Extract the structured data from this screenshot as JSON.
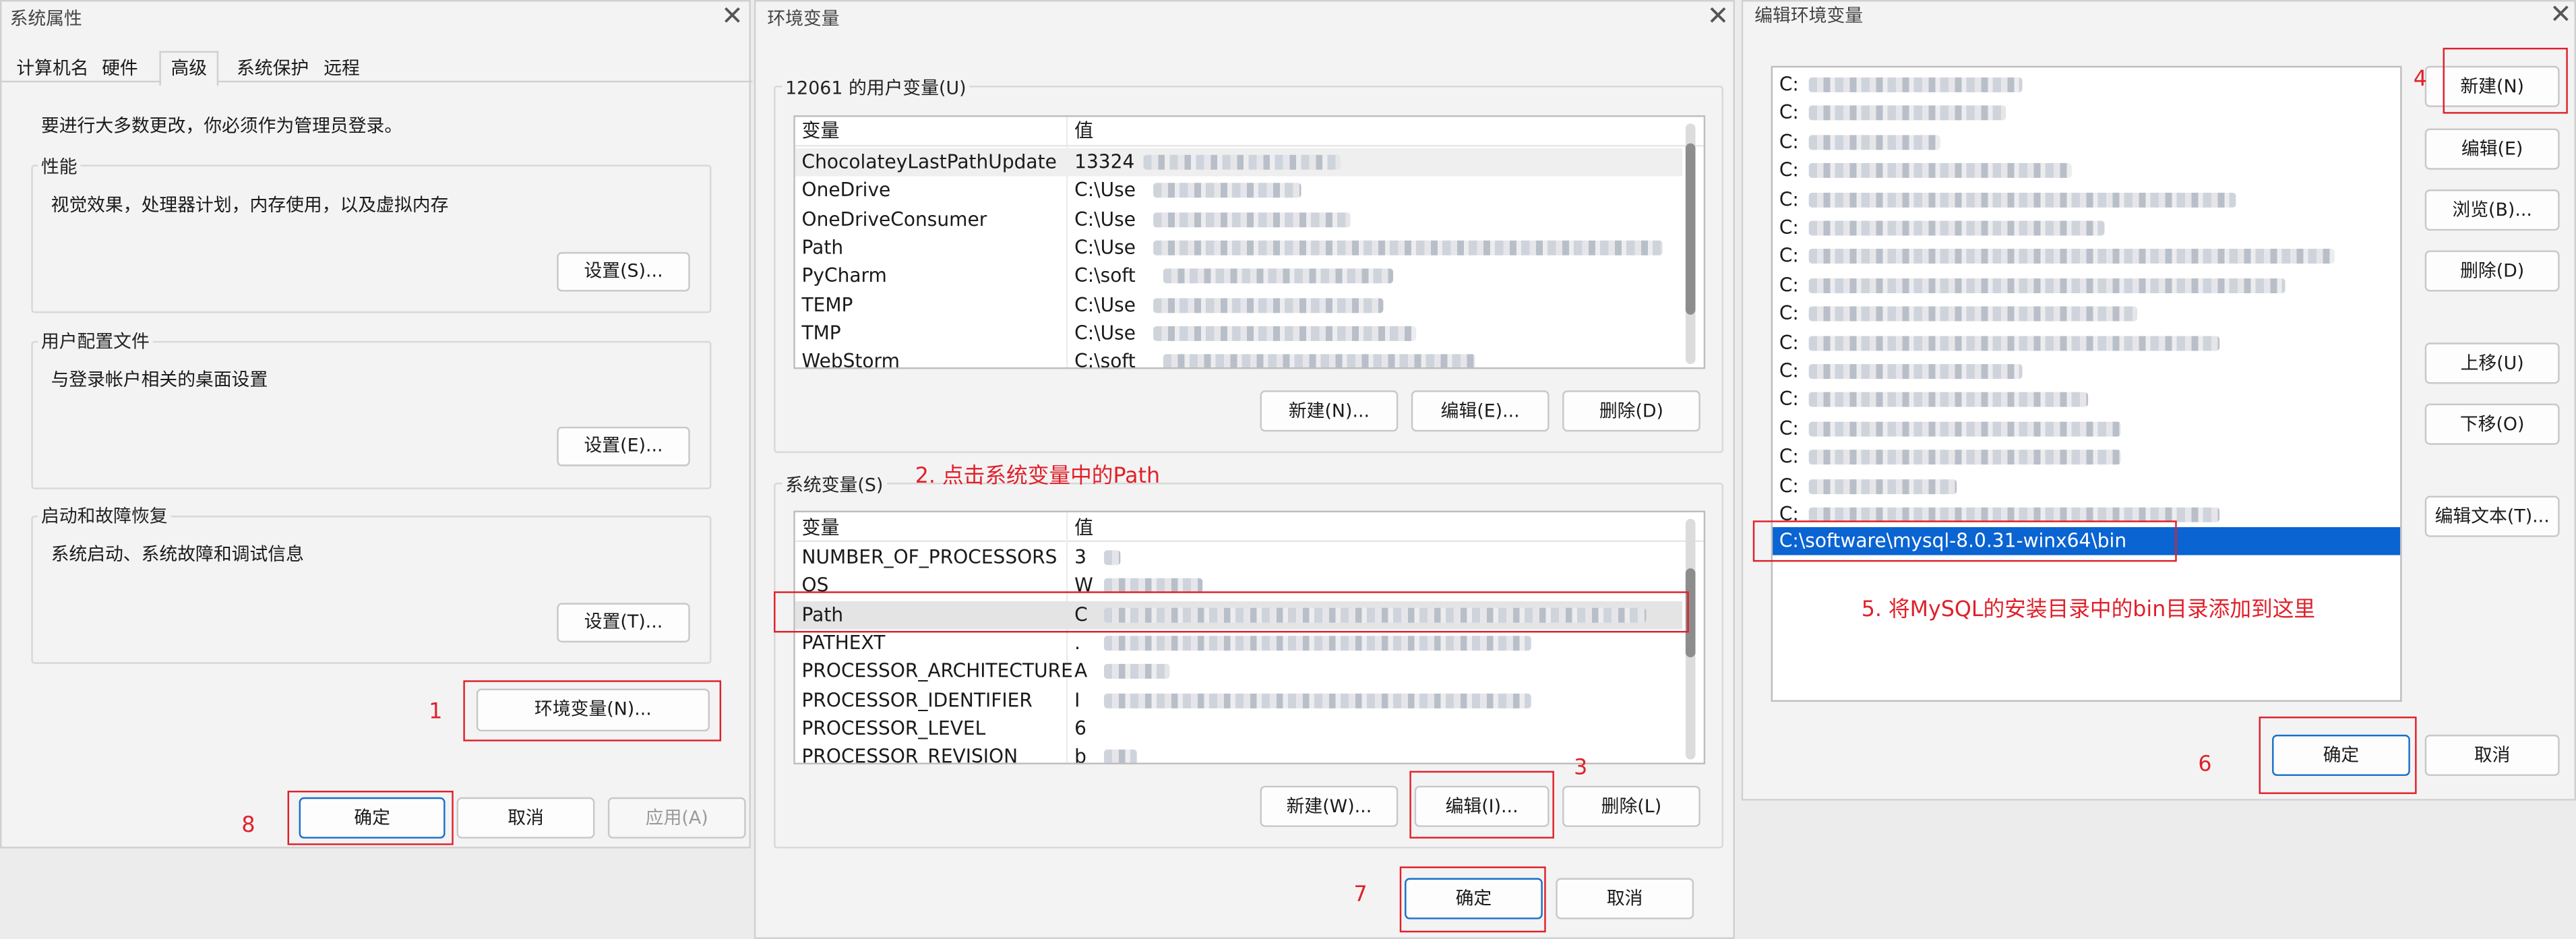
{
  "sys": {
    "title": "系统属性",
    "tabs": [
      "计算机名",
      "硬件",
      "高级",
      "系统保护",
      "远程"
    ],
    "admin_note": "要进行大多数更改，你必须作为管理员登录。",
    "perf_label": "性能",
    "perf_desc": "视觉效果，处理器计划，内存使用，以及虚拟内存",
    "perf_btn": "设置(S)...",
    "profile_label": "用户配置文件",
    "profile_desc": "与登录帐户相关的桌面设置",
    "profile_btn": "设置(E)...",
    "startup_label": "启动和故障恢复",
    "startup_desc": "系统启动、系统故障和调试信息",
    "startup_btn": "设置(T)...",
    "env_btn": "环境变量(N)...",
    "ok": "确定",
    "cancel": "取消",
    "apply": "应用(A)"
  },
  "env": {
    "title": "环境变量",
    "user_label": "12061 的用户变量(U)",
    "col_var": "变量",
    "col_val": "值",
    "user_vars": [
      {
        "name": "ChocolateyLastPathUpdate",
        "value": "13324"
      },
      {
        "name": "OneDrive",
        "value": "C:\\Use"
      },
      {
        "name": "OneDriveConsumer",
        "value": "C:\\Use"
      },
      {
        "name": "Path",
        "value": "C:\\Use"
      },
      {
        "name": "PyCharm",
        "value": "C:\\soft"
      },
      {
        "name": "TEMP",
        "value": "C:\\Use"
      },
      {
        "name": "TMP",
        "value": "C:\\Use"
      },
      {
        "name": "WebStorm",
        "value": "C:\\soft"
      }
    ],
    "user_new": "新建(N)...",
    "user_edit": "编辑(E)...",
    "user_del": "删除(D)",
    "sys_label": "系统变量(S)",
    "sys_vars": [
      {
        "name": "NUMBER_OF_PROCESSORS",
        "value": "3"
      },
      {
        "name": "OS",
        "value": "W"
      },
      {
        "name": "Path",
        "value": "C"
      },
      {
        "name": "PATHEXT",
        "value": "."
      },
      {
        "name": "PROCESSOR_ARCHITECTURE",
        "value": "A"
      },
      {
        "name": "PROCESSOR_IDENTIFIER",
        "value": "I"
      },
      {
        "name": "PROCESSOR_LEVEL",
        "value": "6"
      },
      {
        "name": "PROCESSOR_REVISION",
        "value": "b"
      }
    ],
    "sys_new": "新建(W)...",
    "sys_edit": "编辑(I)...",
    "sys_del": "删除(L)",
    "ok": "确定",
    "cancel": "取消"
  },
  "edit": {
    "title": "编辑环境变量",
    "entries": [
      "C:",
      "C:",
      "C:",
      "C:",
      "C:",
      "C:",
      "C:",
      "C:",
      "C:",
      "C:",
      "C:",
      "C:",
      "C:",
      "C:",
      "C:",
      "C:"
    ],
    "selected": "C:\\software\\mysql-8.0.31-winx64\\bin",
    "btn_new": "新建(N)",
    "btn_edit": "编辑(E)",
    "btn_browse": "浏览(B)...",
    "btn_delete": "删除(D)",
    "btn_up": "上移(U)",
    "btn_down": "下移(O)",
    "btn_edit_text": "编辑文本(T)...",
    "ok": "确定",
    "cancel": "取消"
  },
  "annotations": {
    "n1": "1",
    "n2": "2. 点击系统变量中的Path",
    "n3": "3",
    "n4": "4",
    "n5": "5. 将MySQL的安装目录中的bin目录添加到这里",
    "n6": "6",
    "n7": "7",
    "n8": "8"
  },
  "colors": {
    "annotation": "#e0202a",
    "selection": "#0a64d2",
    "accent": "#1a6fc9"
  }
}
